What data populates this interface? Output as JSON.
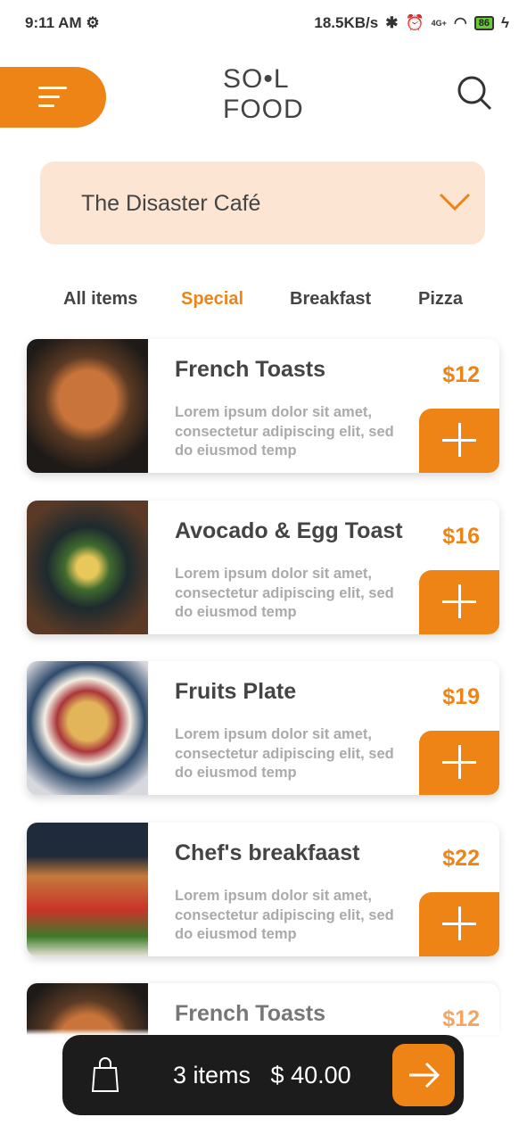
{
  "status": {
    "time": "9:11 AM",
    "speed": "18.5KB/s",
    "network": "4G+",
    "battery": "86"
  },
  "header": {
    "logo_line1": "SO•L",
    "logo_line2": "FOOD"
  },
  "restaurant": {
    "selected": "The Disaster Café"
  },
  "tabs": [
    {
      "label": "All items",
      "active": false
    },
    {
      "label": "Special",
      "active": true
    },
    {
      "label": "Breakfast",
      "active": false
    },
    {
      "label": "Pizza",
      "active": false
    }
  ],
  "items": [
    {
      "name": "French Toasts",
      "price": "$12",
      "description": "Lorem ipsum dolor sit amet, consectetur adipiscing elit, sed do eiusmod temp"
    },
    {
      "name": "Avocado & Egg Toast",
      "price": "$16",
      "description": "Lorem ipsum dolor sit amet, consectetur adipiscing elit, sed do eiusmod temp"
    },
    {
      "name": "Fruits Plate",
      "price": "$19",
      "description": "Lorem ipsum dolor sit amet, consectetur adipiscing elit, sed do eiusmod temp"
    },
    {
      "name": "Chef's breakfaast",
      "price": "$22",
      "description": "Lorem ipsum dolor sit amet, consectetur adipiscing elit, sed do eiusmod temp"
    },
    {
      "name": "French Toasts",
      "price": "$12",
      "description": ""
    }
  ],
  "cart": {
    "count": "3 items",
    "total": "$ 40.00"
  },
  "colors": {
    "accent": "#ef8416",
    "cafe_bg": "#fce6d3",
    "cart_bg": "#1c1c1c"
  }
}
